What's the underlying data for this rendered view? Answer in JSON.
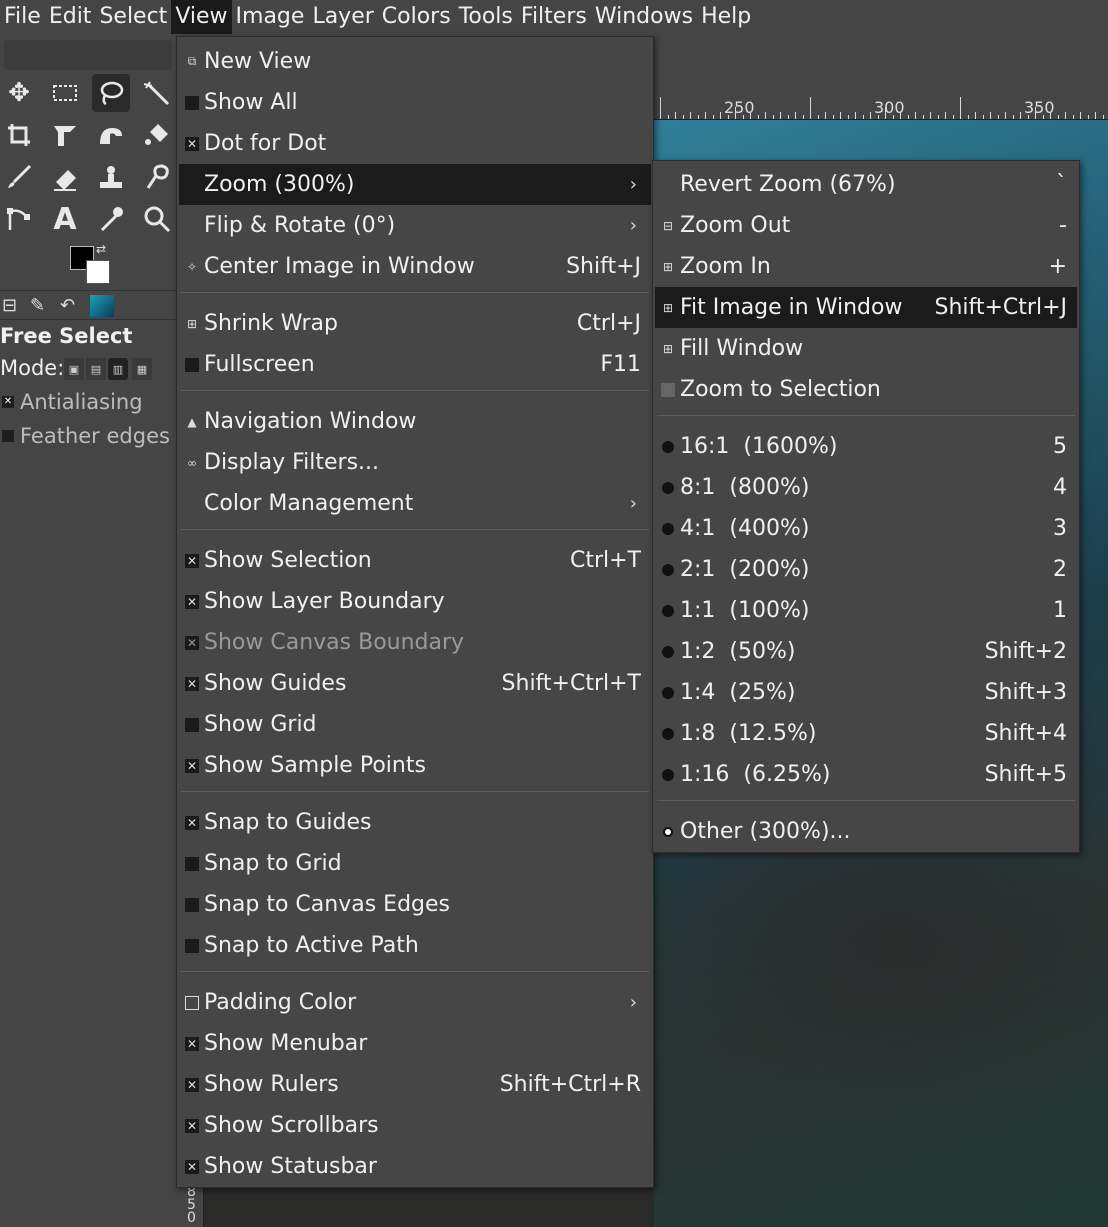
{
  "menubar": [
    "File",
    "Edit",
    "Select",
    "View",
    "Image",
    "Layer",
    "Colors",
    "Tools",
    "Filters",
    "Windows",
    "Help"
  ],
  "toolbox": {
    "tool_title": "Free Select",
    "mode_label": "Mode:",
    "options": [
      {
        "label": "Antialiasing",
        "checked": true
      },
      {
        "label": "Feather edges",
        "checked": false
      }
    ]
  },
  "ruler": {
    "labels": [
      "250",
      "300",
      "350"
    ]
  },
  "left_ruler_digits": [
    "8",
    "5",
    "0"
  ],
  "view_menu": {
    "items": [
      {
        "label": "New View",
        "icon": "new-view-icon"
      },
      {
        "label": "Show All",
        "icon": "checkbox-unchecked"
      },
      {
        "label": "Dot for Dot",
        "icon": "checkbox-checked"
      },
      {
        "label": "Zoom (300%)",
        "submenu": true,
        "highlighted": true
      },
      {
        "label": "Flip & Rotate (0°)",
        "submenu": true
      },
      {
        "label": "Center Image in Window",
        "accel": "Shift+J",
        "icon": "center-icon"
      },
      {
        "label": "Shrink Wrap",
        "accel": "Ctrl+J",
        "icon": "shrink-wrap-icon"
      },
      {
        "label": "Fullscreen",
        "accel": "F11",
        "icon": "checkbox-unchecked"
      },
      {
        "label": "Navigation Window",
        "icon": "navigation-icon"
      },
      {
        "label": "Display Filters...",
        "icon": "display-filters-icon"
      },
      {
        "label": "Color Management",
        "submenu": true
      },
      {
        "label": "Show Selection",
        "accel": "Ctrl+T",
        "icon": "checkbox-checked"
      },
      {
        "label": "Show Layer Boundary",
        "icon": "checkbox-checked"
      },
      {
        "label": "Show Canvas Boundary",
        "icon": "checkbox-checked",
        "disabled": true
      },
      {
        "label": "Show Guides",
        "accel": "Shift+Ctrl+T",
        "icon": "checkbox-checked"
      },
      {
        "label": "Show Grid",
        "icon": "checkbox-unchecked"
      },
      {
        "label": "Show Sample Points",
        "icon": "checkbox-checked"
      },
      {
        "label": "Snap to Guides",
        "icon": "checkbox-checked"
      },
      {
        "label": "Snap to Grid",
        "icon": "checkbox-unchecked"
      },
      {
        "label": "Snap to Canvas Edges",
        "icon": "checkbox-unchecked"
      },
      {
        "label": "Snap to Active Path",
        "icon": "checkbox-unchecked"
      },
      {
        "label": "Padding Color",
        "submenu": true,
        "icon": "padding-color-icon"
      },
      {
        "label": "Show Menubar",
        "icon": "checkbox-checked"
      },
      {
        "label": "Show Rulers",
        "accel": "Shift+Ctrl+R",
        "icon": "checkbox-checked"
      },
      {
        "label": "Show Scrollbars",
        "icon": "checkbox-checked"
      },
      {
        "label": "Show Statusbar",
        "icon": "checkbox-checked"
      }
    ]
  },
  "zoom_menu": {
    "items": [
      {
        "label": "Revert Zoom (67%)",
        "accel": "`"
      },
      {
        "label": "Zoom Out",
        "accel": "-",
        "icon": "zoom-out-icon"
      },
      {
        "label": "Zoom In",
        "accel": "+",
        "icon": "zoom-in-icon"
      },
      {
        "label": "Fit Image in Window",
        "accel": "Shift+Ctrl+J",
        "icon": "fit-image-icon",
        "highlighted": true
      },
      {
        "label": "Fill Window",
        "icon": "fill-window-icon"
      },
      {
        "label": "Zoom to Selection",
        "icon": "zoom-selection-icon"
      },
      {
        "label": "16:1  (1600%)",
        "accel": "5"
      },
      {
        "label": "8:1  (800%)",
        "accel": "4"
      },
      {
        "label": "4:1  (400%)",
        "accel": "3"
      },
      {
        "label": "2:1  (200%)",
        "accel": "2"
      },
      {
        "label": "1:1  (100%)",
        "accel": "1"
      },
      {
        "label": "1:2  (50%)",
        "accel": "Shift+2"
      },
      {
        "label": "1:4  (25%)",
        "accel": "Shift+3"
      },
      {
        "label": "1:8  (12.5%)",
        "accel": "Shift+4"
      },
      {
        "label": "1:16  (6.25%)",
        "accel": "Shift+5"
      },
      {
        "label": "Other (300%)...",
        "selected_radio": true
      }
    ]
  }
}
